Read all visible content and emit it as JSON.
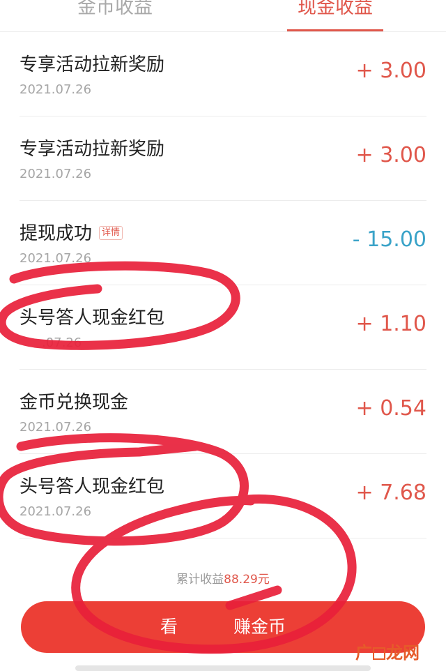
{
  "tabs": {
    "coin_label": "金币收益",
    "cash_label": "现金收益"
  },
  "records": [
    {
      "title": "专享活动拉新奖励",
      "date": "2021.07.26",
      "amount": "+ 3.00",
      "type": "pos"
    },
    {
      "title": "专享活动拉新奖励",
      "date": "2021.07.26",
      "amount": "+ 3.00",
      "type": "pos"
    },
    {
      "title": "提现成功",
      "tag": "详情",
      "date": "2021.07.26",
      "amount": "- 15.00",
      "type": "neg"
    },
    {
      "title": "头号答人现金红包",
      "date": ".07.26",
      "amount": "+ 1.10",
      "type": "pos"
    },
    {
      "title": "金币兑换现金",
      "date": "2021.07.26",
      "amount": "+ 0.54",
      "type": "pos"
    },
    {
      "title": "头号答人现金红包",
      "date": "2021.07.26",
      "amount": "+ 7.68",
      "type": "pos"
    }
  ],
  "summary": {
    "label": "累计收益",
    "value": "88.29元"
  },
  "cta": {
    "label_visible_a": "看",
    "label_visible_b": "赚金币"
  },
  "watermark": {
    "text_a": "广",
    "text_b": "龙网"
  },
  "colors": {
    "accent": "#e0574b",
    "negative": "#3aa3c8",
    "button": "#ec3f36",
    "scribble": "#e8203a"
  }
}
